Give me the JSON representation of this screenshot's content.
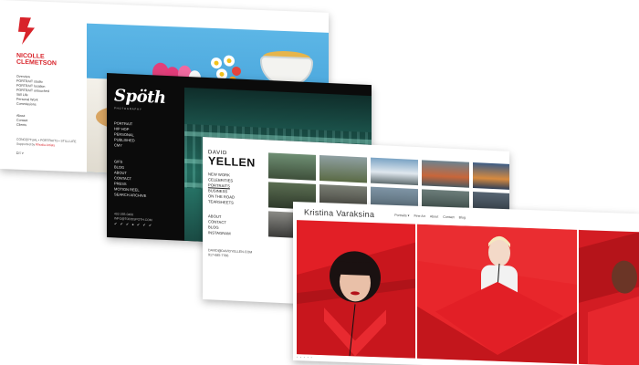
{
  "colors": {
    "brand_red": "#d8232a",
    "spoth_bg": "#0b0b0b",
    "kv_red": "#e21f26"
  },
  "card1": {
    "logo_line1": "NICOLLE",
    "logo_line2": "CLEMETSON",
    "menu": [
      "Overview",
      "PORTRAIT studio",
      "PORTRAIT location",
      "PORTRAIT untouched",
      "Still Life",
      "Personal Work",
      "Commissions"
    ],
    "menu2": [
      "About",
      "Contact",
      "Clients"
    ],
    "footer_line": "CONCEPTUAL • PORTRAITS • STILL LIFE",
    "rep_prefix": "Supported by",
    "rep_link": "Rhodia Artists",
    "social_icons": [
      "instagram-icon",
      "twitter-icon",
      "vimeo-icon"
    ]
  },
  "card2": {
    "logo": "Spöth",
    "logo_sub": "PHOTOGRAPHY",
    "menu": [
      "PORTRAIT",
      "HIP HOP",
      "PERSONAL",
      "PUBLISHED",
      "CMY"
    ],
    "menu2": [
      "GIFS",
      "BLOG",
      "ABOUT",
      "CONTACT",
      "PRESS",
      "MOTION REEL",
      "SEARCH ARCHIVE"
    ],
    "phone": "402-265-0466",
    "email": "INFO@TODDSPOTH.COM",
    "social": "✔ ✔ ✔ ● ✔ ✔ ✔"
  },
  "card3": {
    "logo_a": "DAVID",
    "logo_b": "YELLEN",
    "menu": [
      "NEW WORK",
      "CELEBRITIES",
      "PORTRAITS",
      "BUSINESS",
      "ON THE ROAD",
      "TEARSHEETS"
    ],
    "active_item": "PORTRAITS",
    "menu2": [
      "ABOUT",
      "CONTACT",
      "BLOG",
      "INSTAGRAM"
    ],
    "email": "DAVID@DAVIDYELLEN.COM",
    "phone": "917-685-7786"
  },
  "card4": {
    "brand": "Kristina Varaksina",
    "nav": [
      "Portraits ▾",
      "Fine Art",
      "About",
      "Contact",
      "Blog"
    ]
  }
}
